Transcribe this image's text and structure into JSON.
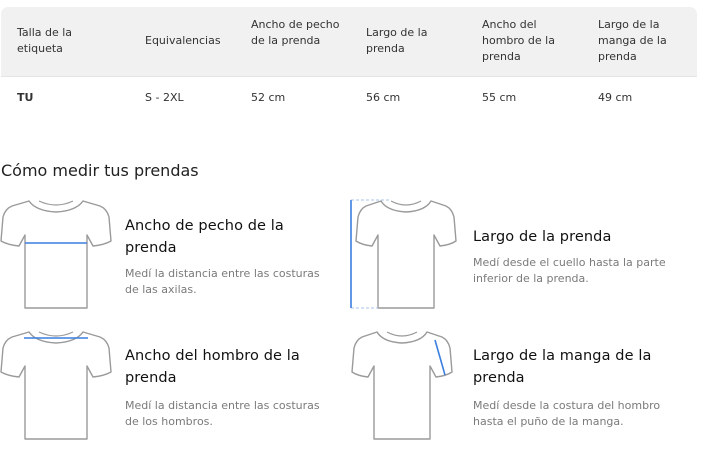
{
  "size_table": {
    "headers": [
      "Talla de la etiqueta",
      "Equivalencias",
      "Ancho de pecho de la prenda",
      "Largo de la prenda",
      "Ancho del hombro de la prenda",
      "Largo de la manga de la prenda"
    ],
    "rows": [
      [
        "TU",
        "S - 2XL",
        "52 cm",
        "56 cm",
        "55 cm",
        "49 cm"
      ]
    ]
  },
  "measure_section": {
    "title": "Cómo medir tus prendas",
    "cards": [
      {
        "heading": "Ancho de pecho de la prenda",
        "description": "Medí la distancia entre las costuras de las axilas.",
        "icon": "tshirt-chest-width-icon"
      },
      {
        "heading": "Largo de la prenda",
        "description": "Medí desde el cuello hasta la parte inferior de la prenda.",
        "icon": "tshirt-length-icon"
      },
      {
        "heading": "Ancho del hombro de la prenda",
        "description": "Medí la distancia entre las costuras de los hombros.",
        "icon": "tshirt-shoulder-width-icon"
      },
      {
        "heading": "Largo de la manga de la prenda",
        "description": "Medí desde la costura del hombro hasta el puño de la manga.",
        "icon": "tshirt-sleeve-length-icon"
      }
    ]
  },
  "colors": {
    "measure_line": "#3b7fe0",
    "header_bg": "#f1f1f1",
    "shirt_outline": "#9a9a9a"
  }
}
